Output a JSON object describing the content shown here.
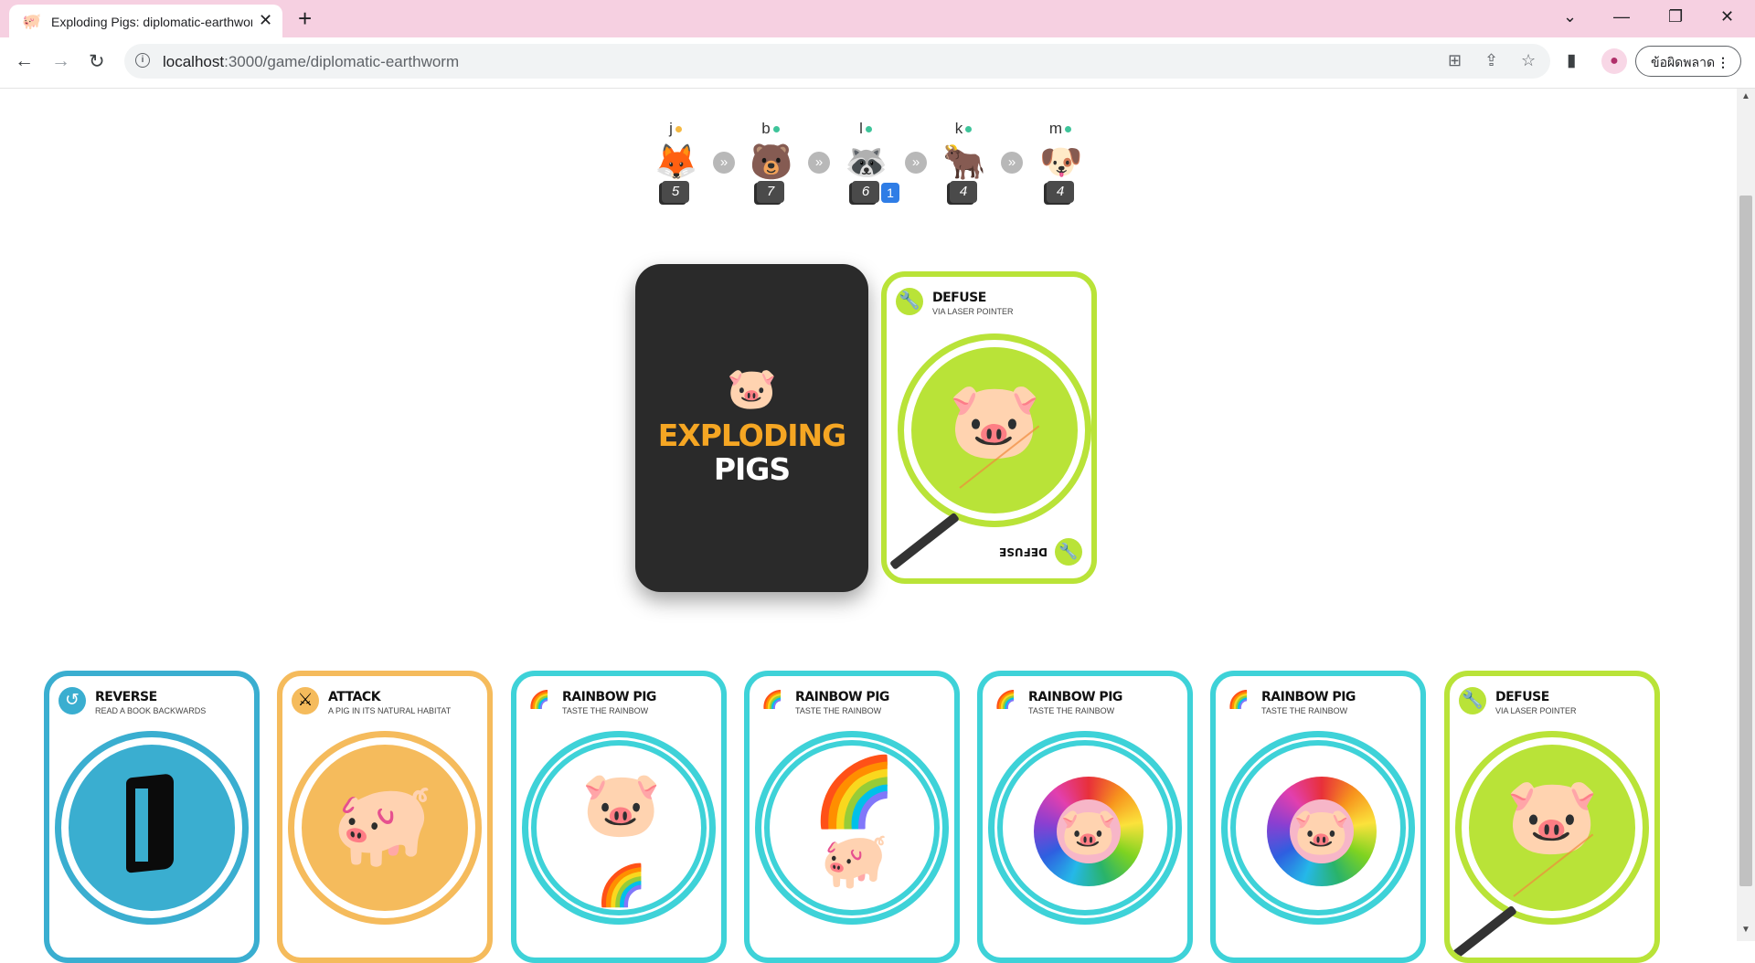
{
  "browser": {
    "tab_title": "Exploding Pigs: diplomatic-earthworm",
    "tab_favicon": "🐖",
    "url_host": "localhost",
    "url_path": ":3000/game/diplomatic-earthworm",
    "error_button": "ข้อผิดพลาด",
    "colors": {
      "tabstrip": "#f6d0e1"
    }
  },
  "players": [
    {
      "name": "j",
      "status_color": "#f5b942",
      "avatar_icon": "fox-avatar-icon",
      "avatar_glyph": "🦊",
      "cards": "5",
      "badge": ""
    },
    {
      "name": "b",
      "status_color": "#3ec49a",
      "avatar_icon": "bear-avatar-icon",
      "avatar_glyph": "🐻",
      "cards": "7",
      "badge": ""
    },
    {
      "name": "l",
      "status_color": "#3ec49a",
      "avatar_icon": "raccoon-avatar-icon",
      "avatar_glyph": "🦝",
      "cards": "6",
      "badge": "1"
    },
    {
      "name": "k",
      "status_color": "#3ec49a",
      "avatar_icon": "bull-avatar-icon",
      "avatar_glyph": "🐂",
      "cards": "4",
      "badge": ""
    },
    {
      "name": "m",
      "status_color": "#3ec49a",
      "avatar_icon": "dog-avatar-icon",
      "avatar_glyph": "🐶",
      "cards": "4",
      "badge": ""
    }
  ],
  "turn_arrow": "»",
  "deck": {
    "title_line1": "EXPLODING",
    "title_line2": "PIGS",
    "logo_icon": "pig-icon",
    "colors": {
      "bg": "#2a2a2a",
      "accent": "#f5a623"
    }
  },
  "discard": {
    "name": "DEFUSE",
    "subtitle": "VIA LASER POINTER",
    "footer": "DEFUSE",
    "icon": "wrench-icon",
    "color": "#b9e338"
  },
  "hand": [
    {
      "name": "REVERSE",
      "subtitle": "READ A BOOK BACKWARDS",
      "icon": "reverse-icon",
      "art": "book-icon",
      "color": "#3aaed0"
    },
    {
      "name": "ATTACK",
      "subtitle": "A PIG IN ITS NATURAL HABITAT",
      "icon": "crossed-swords-icon",
      "art": "pig-with-gun-icon",
      "color": "#f5bb5c"
    },
    {
      "name": "RAINBOW PIG",
      "subtitle": "TASTE THE RAINBOW",
      "icon": "rainbow-icon",
      "art": "pig-rainbow-vomit-icon",
      "color": "#3ed2d8"
    },
    {
      "name": "RAINBOW PIG",
      "subtitle": "TASTE THE RAINBOW",
      "icon": "rainbow-icon",
      "art": "pig-under-rainbow-icon",
      "color": "#3ed2d8"
    },
    {
      "name": "RAINBOW PIG",
      "subtitle": "TASTE THE RAINBOW",
      "icon": "rainbow-icon",
      "art": "pig-flower-icon",
      "color": "#3ed2d8"
    },
    {
      "name": "RAINBOW PIG",
      "subtitle": "TASTE THE RAINBOW",
      "icon": "rainbow-icon",
      "art": "pig-flower-icon",
      "color": "#3ed2d8"
    },
    {
      "name": "DEFUSE",
      "subtitle": "VIA LASER POINTER",
      "icon": "wrench-icon",
      "art": "pig-laser-icon",
      "color": "#b9e338"
    }
  ]
}
